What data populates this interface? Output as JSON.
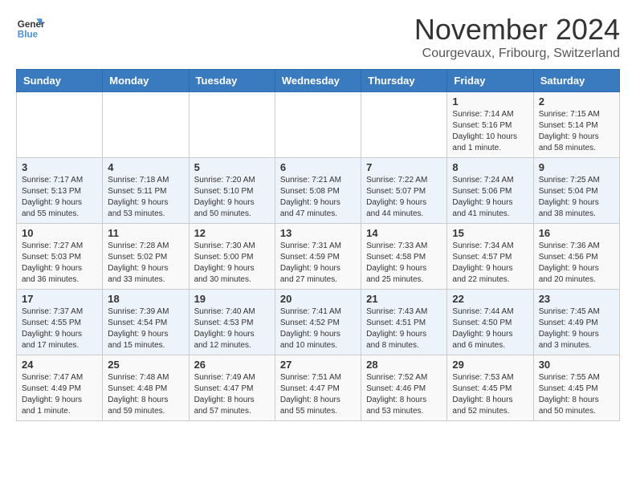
{
  "logo": {
    "line1": "General",
    "line2": "Blue"
  },
  "title": "November 2024",
  "location": "Courgevaux, Fribourg, Switzerland",
  "weekdays": [
    "Sunday",
    "Monday",
    "Tuesday",
    "Wednesday",
    "Thursday",
    "Friday",
    "Saturday"
  ],
  "weeks": [
    [
      {
        "day": "",
        "info": ""
      },
      {
        "day": "",
        "info": ""
      },
      {
        "day": "",
        "info": ""
      },
      {
        "day": "",
        "info": ""
      },
      {
        "day": "",
        "info": ""
      },
      {
        "day": "1",
        "info": "Sunrise: 7:14 AM\nSunset: 5:16 PM\nDaylight: 10 hours and 1 minute."
      },
      {
        "day": "2",
        "info": "Sunrise: 7:15 AM\nSunset: 5:14 PM\nDaylight: 9 hours and 58 minutes."
      }
    ],
    [
      {
        "day": "3",
        "info": "Sunrise: 7:17 AM\nSunset: 5:13 PM\nDaylight: 9 hours and 55 minutes."
      },
      {
        "day": "4",
        "info": "Sunrise: 7:18 AM\nSunset: 5:11 PM\nDaylight: 9 hours and 53 minutes."
      },
      {
        "day": "5",
        "info": "Sunrise: 7:20 AM\nSunset: 5:10 PM\nDaylight: 9 hours and 50 minutes."
      },
      {
        "day": "6",
        "info": "Sunrise: 7:21 AM\nSunset: 5:08 PM\nDaylight: 9 hours and 47 minutes."
      },
      {
        "day": "7",
        "info": "Sunrise: 7:22 AM\nSunset: 5:07 PM\nDaylight: 9 hours and 44 minutes."
      },
      {
        "day": "8",
        "info": "Sunrise: 7:24 AM\nSunset: 5:06 PM\nDaylight: 9 hours and 41 minutes."
      },
      {
        "day": "9",
        "info": "Sunrise: 7:25 AM\nSunset: 5:04 PM\nDaylight: 9 hours and 38 minutes."
      }
    ],
    [
      {
        "day": "10",
        "info": "Sunrise: 7:27 AM\nSunset: 5:03 PM\nDaylight: 9 hours and 36 minutes."
      },
      {
        "day": "11",
        "info": "Sunrise: 7:28 AM\nSunset: 5:02 PM\nDaylight: 9 hours and 33 minutes."
      },
      {
        "day": "12",
        "info": "Sunrise: 7:30 AM\nSunset: 5:00 PM\nDaylight: 9 hours and 30 minutes."
      },
      {
        "day": "13",
        "info": "Sunrise: 7:31 AM\nSunset: 4:59 PM\nDaylight: 9 hours and 27 minutes."
      },
      {
        "day": "14",
        "info": "Sunrise: 7:33 AM\nSunset: 4:58 PM\nDaylight: 9 hours and 25 minutes."
      },
      {
        "day": "15",
        "info": "Sunrise: 7:34 AM\nSunset: 4:57 PM\nDaylight: 9 hours and 22 minutes."
      },
      {
        "day": "16",
        "info": "Sunrise: 7:36 AM\nSunset: 4:56 PM\nDaylight: 9 hours and 20 minutes."
      }
    ],
    [
      {
        "day": "17",
        "info": "Sunrise: 7:37 AM\nSunset: 4:55 PM\nDaylight: 9 hours and 17 minutes."
      },
      {
        "day": "18",
        "info": "Sunrise: 7:39 AM\nSunset: 4:54 PM\nDaylight: 9 hours and 15 minutes."
      },
      {
        "day": "19",
        "info": "Sunrise: 7:40 AM\nSunset: 4:53 PM\nDaylight: 9 hours and 12 minutes."
      },
      {
        "day": "20",
        "info": "Sunrise: 7:41 AM\nSunset: 4:52 PM\nDaylight: 9 hours and 10 minutes."
      },
      {
        "day": "21",
        "info": "Sunrise: 7:43 AM\nSunset: 4:51 PM\nDaylight: 9 hours and 8 minutes."
      },
      {
        "day": "22",
        "info": "Sunrise: 7:44 AM\nSunset: 4:50 PM\nDaylight: 9 hours and 6 minutes."
      },
      {
        "day": "23",
        "info": "Sunrise: 7:45 AM\nSunset: 4:49 PM\nDaylight: 9 hours and 3 minutes."
      }
    ],
    [
      {
        "day": "24",
        "info": "Sunrise: 7:47 AM\nSunset: 4:49 PM\nDaylight: 9 hours and 1 minute."
      },
      {
        "day": "25",
        "info": "Sunrise: 7:48 AM\nSunset: 4:48 PM\nDaylight: 8 hours and 59 minutes."
      },
      {
        "day": "26",
        "info": "Sunrise: 7:49 AM\nSunset: 4:47 PM\nDaylight: 8 hours and 57 minutes."
      },
      {
        "day": "27",
        "info": "Sunrise: 7:51 AM\nSunset: 4:47 PM\nDaylight: 8 hours and 55 minutes."
      },
      {
        "day": "28",
        "info": "Sunrise: 7:52 AM\nSunset: 4:46 PM\nDaylight: 8 hours and 53 minutes."
      },
      {
        "day": "29",
        "info": "Sunrise: 7:53 AM\nSunset: 4:45 PM\nDaylight: 8 hours and 52 minutes."
      },
      {
        "day": "30",
        "info": "Sunrise: 7:55 AM\nSunset: 4:45 PM\nDaylight: 8 hours and 50 minutes."
      }
    ]
  ]
}
